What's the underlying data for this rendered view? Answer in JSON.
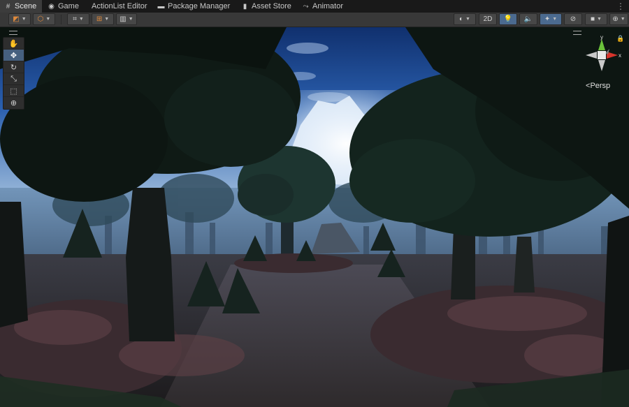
{
  "tabs": [
    {
      "label": "Scene",
      "icon": "grid-icon"
    },
    {
      "label": "Game",
      "icon": "gamepad-icon"
    },
    {
      "label": "ActionList Editor",
      "icon": ""
    },
    {
      "label": "Package Manager",
      "icon": "package-icon"
    },
    {
      "label": "Asset Store",
      "icon": "bag-icon"
    },
    {
      "label": "Animator",
      "icon": "animator-icon"
    }
  ],
  "toolbar": {
    "two_d_label": "2D",
    "left_buttons": [
      "draw-mode-icon",
      "shading-icon",
      "grid-snap-icon",
      "increment-snap-icon",
      "pivot-icon"
    ],
    "right_buttons": [
      "render-mode-icon",
      "lighting-icon",
      "audio-icon",
      "effects-icon",
      "hidden-icon",
      "camera-icon",
      "gizmos-icon"
    ]
  },
  "tools": [
    "hand-tool-icon",
    "move-tool-icon",
    "rotate-tool-icon",
    "scale-tool-icon",
    "rect-tool-icon",
    "transform-tool-icon"
  ],
  "gizmo": {
    "y_label": "y",
    "x_label": "x",
    "projection_label": "Persp"
  },
  "colors": {
    "accent": "#4b6a8f",
    "sky": "#1f4f9a",
    "fog": "#7e9fc0"
  }
}
